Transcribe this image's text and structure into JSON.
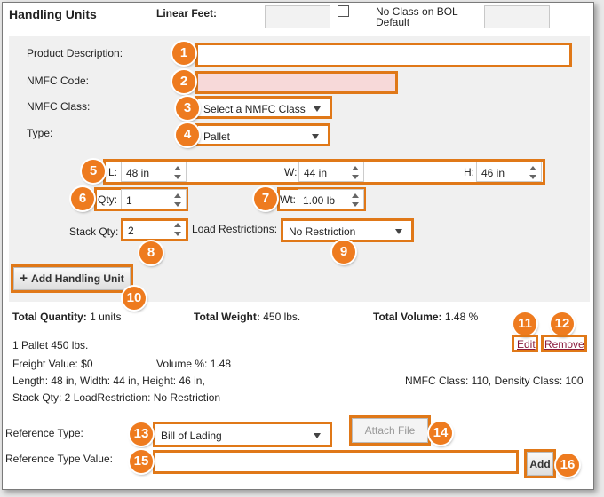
{
  "header": {
    "title": "Handling Units",
    "linear_feet_label": "Linear Feet:",
    "no_class_label": "No Class on BOL Default"
  },
  "form": {
    "product_description_label": "Product Description:",
    "nmfc_code_label": "NMFC Code:",
    "nmfc_class_label": "NMFC Class:",
    "nmfc_class_value": "Select a NMFC Class",
    "type_label": "Type:",
    "type_value": "Pallet"
  },
  "dimensions": {
    "length_label": "L:",
    "length_value": "48 in",
    "width_label": "W:",
    "width_value": "44 in",
    "height_label": "H:",
    "height_value": "46 in",
    "qty_label": "Qty:",
    "qty_value": "1",
    "weight_label": "Wt:",
    "weight_value": "1.00 lb",
    "stack_qty_label": "Stack Qty:",
    "stack_qty_value": "2",
    "load_restrictions_label": "Load Restrictions:",
    "load_restrictions_value": "No Restriction"
  },
  "add_handling_unit_label": "Add Handling Unit",
  "totals": {
    "quantity_label": "Total Quantity:",
    "quantity_value": "1 units",
    "weight_label": "Total Weight:",
    "weight_value": "450 lbs.",
    "volume_label": "Total Volume:",
    "volume_value": "1.48 %"
  },
  "summary": {
    "line1": "1 Pallet 450 lbs.",
    "freight_value": "Freight Value: $0",
    "volume_pct": "Volume %: 1.48",
    "dims": "Length: 48 in, Width: 44 in, Height: 46 in,",
    "nmfc": "NMFC Class: 110, Density Class: 100",
    "stack": "Stack Qty: 2 LoadRestriction: No Restriction",
    "edit_label": "Edit",
    "remove_label": "Remove"
  },
  "reference": {
    "type_label": "Reference Type:",
    "type_value": "Bill of Lading",
    "attach_file_label": "Attach File",
    "value_label": "Reference Type Value:",
    "add_label": "Add"
  },
  "badges": [
    "1",
    "2",
    "3",
    "4",
    "5",
    "6",
    "7",
    "8",
    "9",
    "10",
    "11",
    "12",
    "13",
    "14",
    "15",
    "16"
  ],
  "colors": {
    "accent": "#ee7b1f",
    "link": "#8a1a3a",
    "nmfc_code_bg": "#f7d9d9"
  }
}
